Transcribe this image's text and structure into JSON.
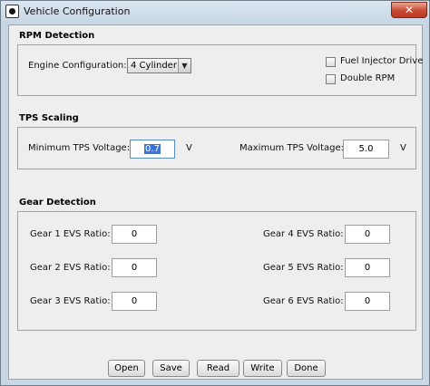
{
  "window": {
    "title": "Vehicle Configuration",
    "close_symbol": "✕"
  },
  "rpm": {
    "section_title": "RPM Detection",
    "engine_config_label": "Engine Configuration:",
    "engine_config_value": "4 Cylinder",
    "fuel_injector_label": "Fuel Injector Drive",
    "fuel_injector_checked": false,
    "double_rpm_label": "Double RPM",
    "double_rpm_checked": false
  },
  "tps": {
    "section_title": "TPS Scaling",
    "min_label": "Minimum TPS Voltage:",
    "min_value": "0.7",
    "min_unit": "V",
    "max_label": "Maximum TPS Voltage:",
    "max_value": "5.0",
    "max_unit": "V"
  },
  "gear": {
    "section_title": "Gear Detection",
    "gears": [
      {
        "label": "Gear 1 EVS Ratio:",
        "value": "0"
      },
      {
        "label": "Gear 2 EVS Ratio:",
        "value": "0"
      },
      {
        "label": "Gear 3 EVS Ratio:",
        "value": "0"
      },
      {
        "label": "Gear 4 EVS Ratio:",
        "value": "0"
      },
      {
        "label": "Gear 5 EVS Ratio:",
        "value": "0"
      },
      {
        "label": "Gear 6 EVS Ratio:",
        "value": "0"
      }
    ]
  },
  "buttons": {
    "open": "Open",
    "save": "Save",
    "read": "Read",
    "write": "Write",
    "done": "Done"
  }
}
